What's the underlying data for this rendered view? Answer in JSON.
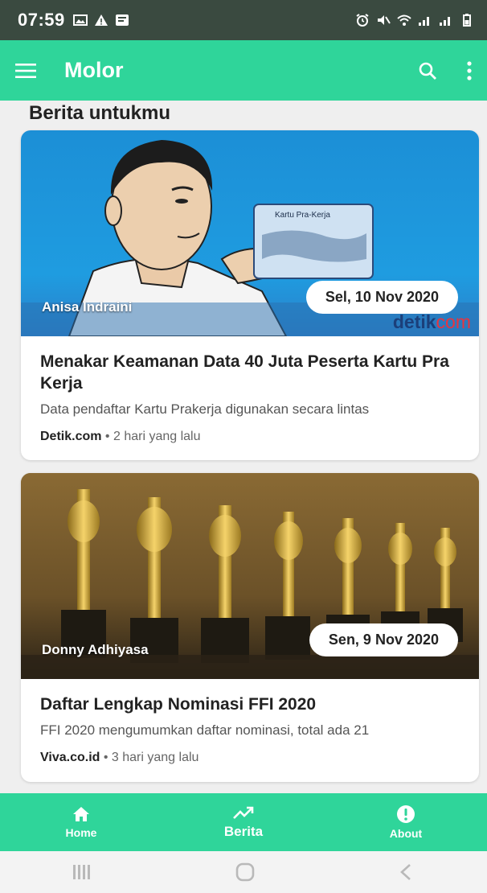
{
  "status_bar": {
    "time": "07:59"
  },
  "app_bar": {
    "title": "Molor"
  },
  "section": {
    "title": "Berita untukmu"
  },
  "articles": [
    {
      "author": "Anisa Indraini",
      "date": "Sel, 10 Nov 2020",
      "image_text": "Kartu Pra-Kerja",
      "logo_main": "detik",
      "logo_suffix": "com",
      "title": "Menakar Keamanan Data 40 Juta Peserta Kartu Pra Kerja",
      "snippet": "Data pendaftar Kartu Prakerja digunakan secara lintas",
      "source": "Detik.com",
      "time_ago": "2 hari yang lalu"
    },
    {
      "author": "Donny Adhiyasa",
      "date": "Sen, 9 Nov 2020",
      "title": "Daftar Lengkap Nominasi FFI 2020",
      "snippet": "FFI 2020 mengumumkan daftar nominasi, total ada 21",
      "source": "Viva.co.id",
      "time_ago": "3 hari yang lalu"
    }
  ],
  "bottom_nav": [
    {
      "label": "Home",
      "icon": "home-icon"
    },
    {
      "label": "Berita",
      "icon": "trending-icon"
    },
    {
      "label": "About",
      "icon": "info-icon"
    }
  ],
  "colors": {
    "accent": "#2fd59a",
    "status_bar": "#3a4a40"
  }
}
